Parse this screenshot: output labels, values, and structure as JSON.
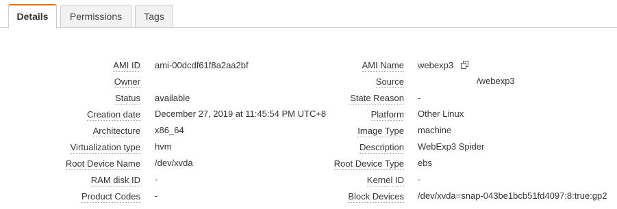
{
  "tabs": [
    {
      "label": "Details"
    },
    {
      "label": "Permissions"
    },
    {
      "label": "Tags"
    }
  ],
  "left_rows": [
    {
      "label": "AMI ID",
      "value": "ami-00dcdf61f8a2aa2bf"
    },
    {
      "label": "Owner",
      "value": ""
    },
    {
      "label": "Status",
      "value": "available"
    },
    {
      "label": "Creation date",
      "value": "December 27, 2019 at 11:45:54 PM UTC+8"
    },
    {
      "label": "Architecture",
      "value": "x86_64"
    },
    {
      "label": "Virtualization type",
      "value": "hvm"
    },
    {
      "label": "Root Device Name",
      "value": "/dev/xvda"
    },
    {
      "label": "RAM disk ID",
      "value": "-"
    },
    {
      "label": "Product Codes",
      "value": "-"
    }
  ],
  "right_rows": [
    {
      "label": "AMI Name",
      "value": "webexp3"
    },
    {
      "label": "Source",
      "value": "/webexp3"
    },
    {
      "label": "State Reason",
      "value": "-"
    },
    {
      "label": "Platform",
      "value": "Other Linux"
    },
    {
      "label": "Image Type",
      "value": "machine"
    },
    {
      "label": "Description",
      "value": "WebExp3 Spider"
    },
    {
      "label": "Root Device Type",
      "value": "ebs"
    },
    {
      "label": "Kernel ID",
      "value": "-"
    },
    {
      "label": "Block Devices",
      "value": "/dev/xvda=snap-043be1bcb51fd4097:8:true:gp2"
    }
  ],
  "icons": {
    "copy": "copy-icon"
  }
}
